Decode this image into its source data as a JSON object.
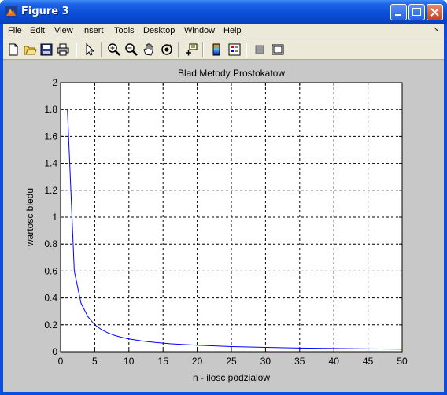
{
  "window": {
    "title": "Figure 3"
  },
  "menu": [
    "File",
    "Edit",
    "View",
    "Insert",
    "Tools",
    "Desktop",
    "Window",
    "Help"
  ],
  "toolbar_icons": [
    "new-figure-icon",
    "open-file-icon",
    "save-icon",
    "print-icon",
    "edit-plot-arrow-icon",
    "zoom-in-icon",
    "zoom-out-icon",
    "pan-hand-icon",
    "rotate-3d-icon",
    "data-cursor-icon",
    "colorbar-icon",
    "legend-icon",
    "hide-plot-tools-icon",
    "show-plot-tools-icon"
  ],
  "chart_data": {
    "type": "line",
    "title": "Blad Metody Prostokatow",
    "xlabel": "n - ilosc podzialow",
    "ylabel": "wartosc bledu",
    "xlim": [
      0,
      50
    ],
    "ylim": [
      0,
      2
    ],
    "xticks": [
      0,
      5,
      10,
      15,
      20,
      25,
      30,
      35,
      40,
      45,
      50
    ],
    "yticks": [
      0,
      0.2,
      0.4,
      0.6,
      0.8,
      1,
      1.2,
      1.4,
      1.6,
      1.8,
      2
    ],
    "grid": true,
    "series": [
      {
        "color": "#0000ff",
        "x": [
          1,
          2,
          3,
          4,
          5,
          6,
          7,
          8,
          9,
          10,
          12,
          14,
          16,
          18,
          20,
          25,
          30,
          35,
          40,
          45,
          50
        ],
        "y": [
          1.8,
          0.6,
          0.36,
          0.26,
          0.2,
          0.164,
          0.138,
          0.12,
          0.106,
          0.095,
          0.079,
          0.068,
          0.059,
          0.053,
          0.048,
          0.038,
          0.032,
          0.027,
          0.024,
          0.021,
          0.019
        ]
      }
    ]
  }
}
